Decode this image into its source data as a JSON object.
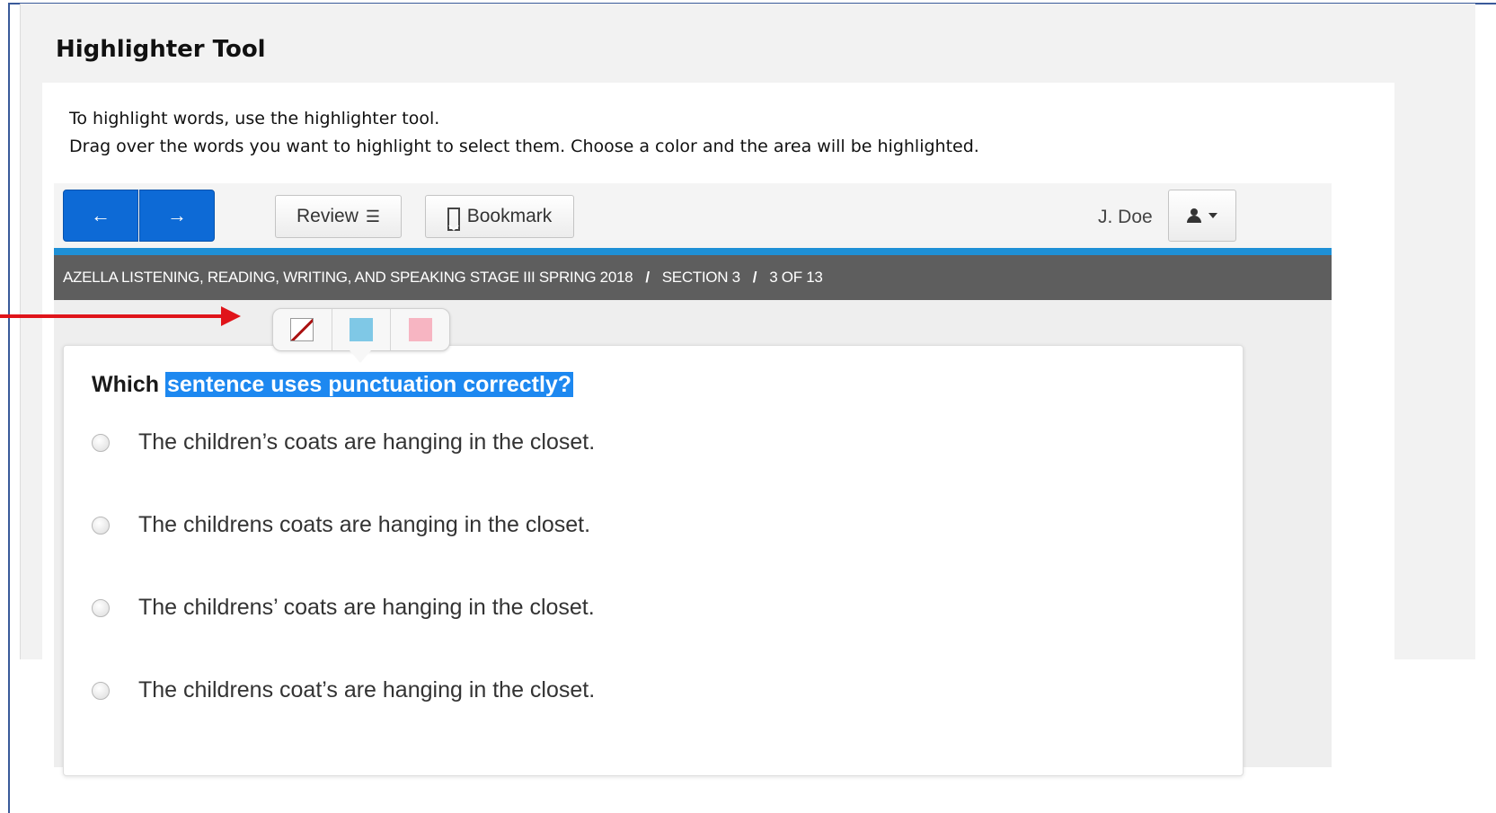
{
  "page": {
    "title": "Highlighter Tool",
    "instruction_1": "To highlight words, use the highlighter tool.",
    "instruction_2": "Drag over the words you want to highlight to select them. Choose a color and the area will be highlighted."
  },
  "toolbar": {
    "prev_icon": "←",
    "next_icon": "→",
    "review_label": "Review",
    "review_icon": "☰",
    "bookmark_label": "Bookmark",
    "bookmark_icon": "🔖",
    "user_name": "J. Doe",
    "user_icon": "▲▾"
  },
  "breadcrumb": {
    "test": "AZELLA LISTENING, READING, WRITING, AND SPEAKING STAGE III SPRING 2018",
    "section": "SECTION 3",
    "position": "3 OF 13",
    "separator": "/"
  },
  "highlighter": {
    "colors": [
      {
        "name": "none",
        "hex": "#ffffff"
      },
      {
        "name": "blue",
        "hex": "#7fc8e6"
      },
      {
        "name": "pink",
        "hex": "#f7b5c2"
      }
    ]
  },
  "question": {
    "prefix": "Which",
    "highlighted": "sentence uses punctuation correctly?",
    "highlight_color": "#1d88f0",
    "options": [
      "The children’s coats are hanging in the closet.",
      "The childrens coats are hanging in the closet.",
      "The childrens’ coats are hanging in the closet.",
      "The childrens coat’s are hanging in the closet."
    ]
  },
  "colors": {
    "nav_blue": "#0d6ad6",
    "accent_line": "#1e90d6",
    "breadcrumb_bg": "#5e5e5e",
    "annotation_arrow": "#e0141a"
  }
}
